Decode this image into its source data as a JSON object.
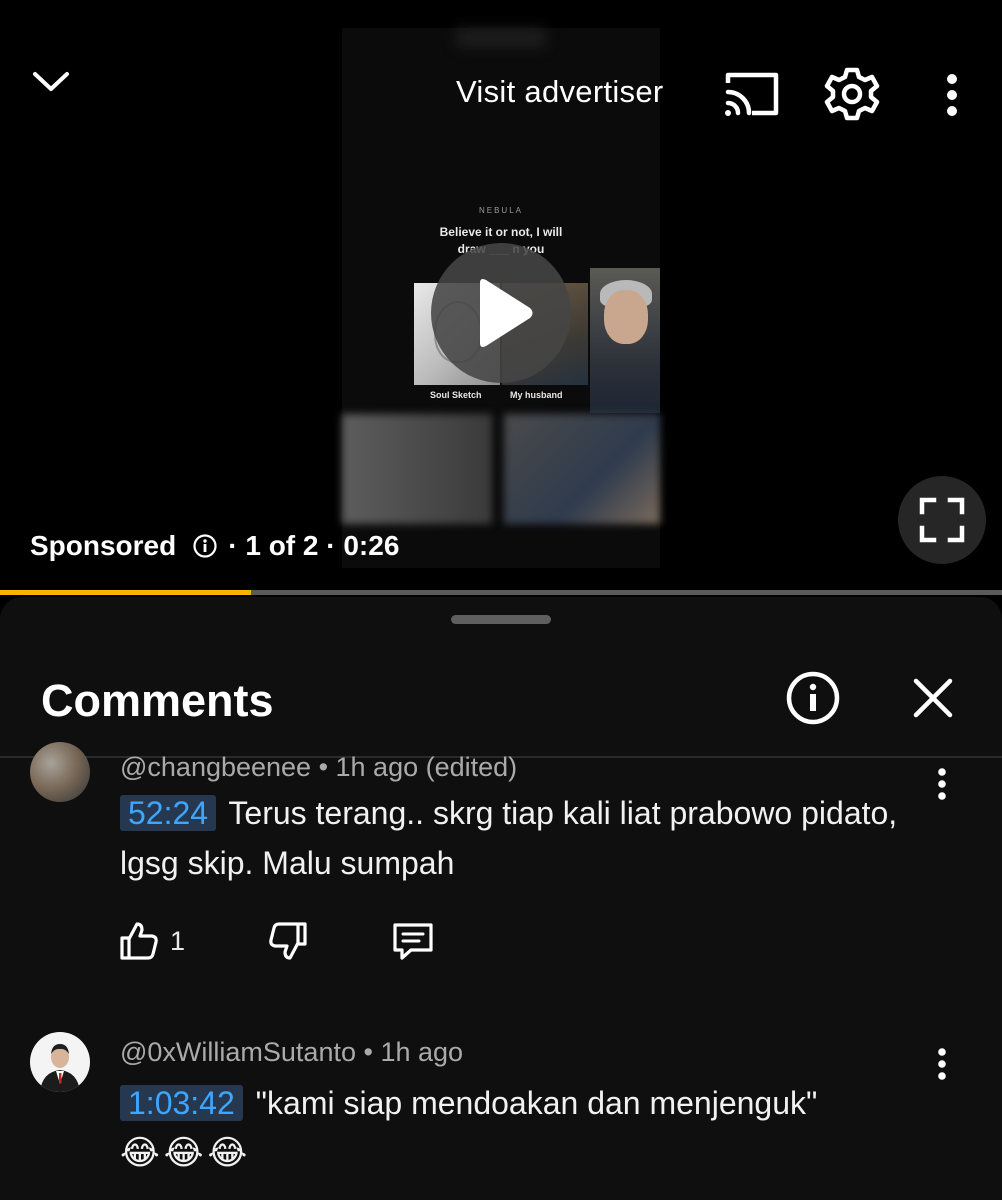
{
  "player": {
    "visit_advertiser_label": "Visit advertiser",
    "ad_content": {
      "brand": "NEBULA",
      "caption_line1": "Believe it or not, I will",
      "caption_line2": "draw ___ n you",
      "panel_left_label": "Soul Sketch",
      "panel_mid_label": "My husband"
    },
    "ad_meta": {
      "sponsored_label": "Sponsored",
      "position_label": "· 1 of 2 · 0:26"
    },
    "progress_fraction": 0.25,
    "colors": {
      "progress": "#f4b400",
      "track": "#5a5a5a"
    }
  },
  "comments_panel": {
    "title": "Comments",
    "comments": [
      {
        "author_line": "@changbeenee • 1h ago (edited)",
        "timestamp": "52:24",
        "text": "Terus terang.. skrg tiap kali liat prabowo pidato, lgsg skip. Malu sumpah",
        "like_count": "1"
      },
      {
        "author_line": "@0xWilliamSutanto • 1h ago",
        "timestamp": "1:03:42",
        "text": "\"kami siap mendoakan dan menjenguk\"",
        "emojis": "😂😂😂"
      }
    ],
    "colors": {
      "timestamp_link": "#3ea6ff",
      "timestamp_bg": "#263850"
    }
  },
  "icons": [
    "chevron-down-icon",
    "cast-icon",
    "gear-icon",
    "more-vertical-icon",
    "play-icon",
    "fullscreen-icon",
    "info-icon",
    "close-icon",
    "thumbs-up-icon",
    "thumbs-down-icon",
    "reply-icon"
  ]
}
